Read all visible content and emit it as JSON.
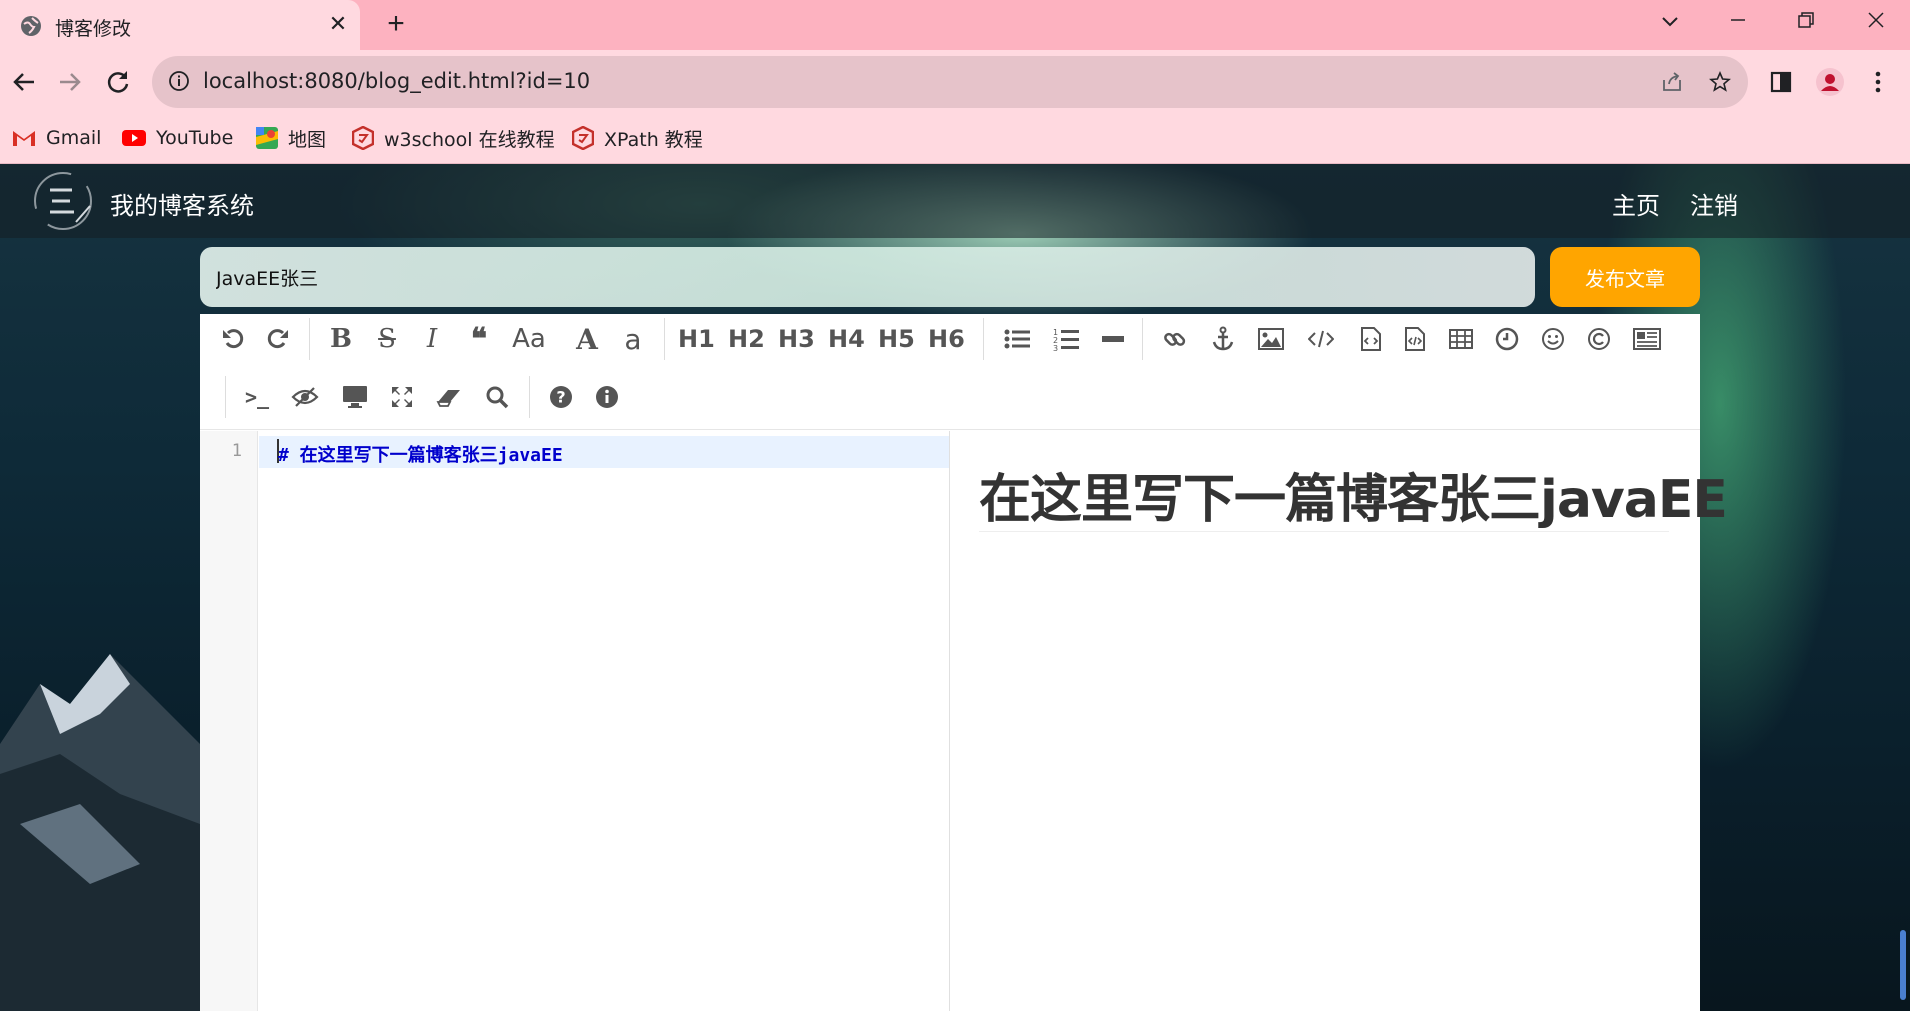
{
  "browser": {
    "tab_title": "博客修改",
    "url": "localhost:8080/blog_edit.html?id=10",
    "bookmarks": [
      {
        "label": "Gmail",
        "icon": "gmail-icon"
      },
      {
        "label": "YouTube",
        "icon": "youtube-icon"
      },
      {
        "label": "地图",
        "icon": "maps-icon"
      },
      {
        "label": "w3school 在线教程",
        "icon": "w3school-icon"
      },
      {
        "label": "XPath 教程",
        "icon": "w3school-icon"
      }
    ]
  },
  "site": {
    "title": "我的博客系统",
    "nav": {
      "home": "主页",
      "logout": "注销"
    }
  },
  "editor": {
    "title_value": "JavaEE张三",
    "publish_label": "发布文章",
    "headings": [
      "H1",
      "H2",
      "H3",
      "H4",
      "H5",
      "H6"
    ],
    "line_number": "1",
    "markdown": "# 在这里写下一篇博客张三javaEE",
    "preview_heading": "在这里写下一篇博客张三javaEE"
  },
  "colors": {
    "tab_bar": "#fdb2c0",
    "chrome": "#ffd9e0",
    "publish_button": "#ffa500",
    "markdown_heading": "#0000cc"
  }
}
